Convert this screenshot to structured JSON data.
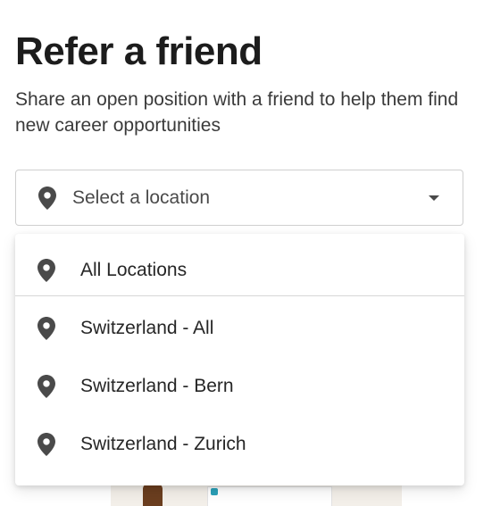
{
  "header": {
    "title": "Refer a friend",
    "subtitle": "Share an open position with a friend to help them find new career opportunities"
  },
  "location_select": {
    "placeholder": "Select a location",
    "icon": "location-pin-icon",
    "caret_icon": "caret-down-icon",
    "expanded": true
  },
  "location_options": [
    {
      "label": "All Locations",
      "icon": "location-pin-icon"
    },
    {
      "label": "Switzerland - All",
      "icon": "location-pin-icon"
    },
    {
      "label": "Switzerland - Bern",
      "icon": "location-pin-icon"
    },
    {
      "label": "Switzerland - Zurich",
      "icon": "location-pin-icon"
    }
  ],
  "colors": {
    "text_primary": "#1c1c1c",
    "text_secondary": "#3a3a3a",
    "icon": "#4a4a4a",
    "border": "#cfcfcf",
    "background": "#ffffff"
  }
}
